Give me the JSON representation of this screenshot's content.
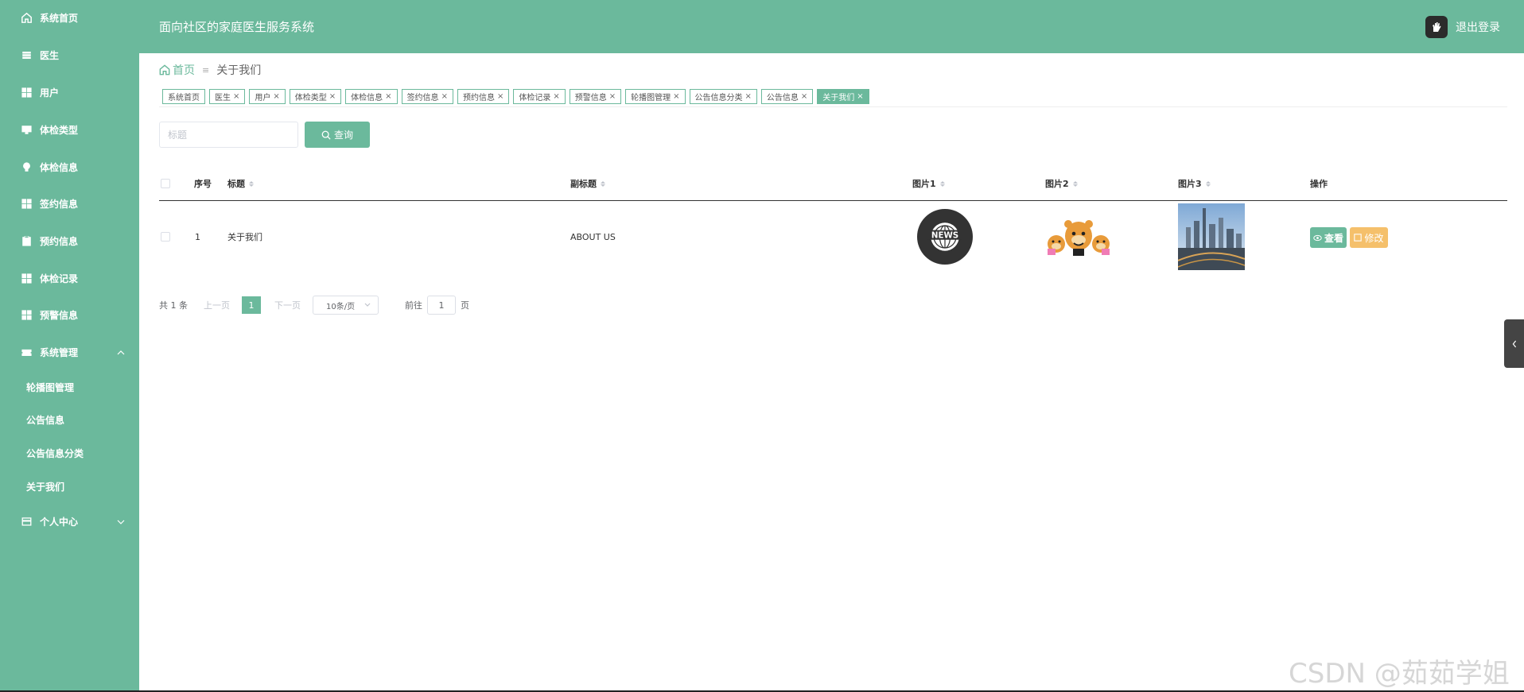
{
  "app_title": "面向社区的家庭医生服务系统",
  "logout_label": "退出登录",
  "sidebar": {
    "items": [
      {
        "label": "系统首页",
        "icon": "home-icon"
      },
      {
        "label": "医生",
        "icon": "menu-icon"
      },
      {
        "label": "用户",
        "icon": "grid-icon"
      },
      {
        "label": "体检类型",
        "icon": "monitor-icon"
      },
      {
        "label": "体检信息",
        "icon": "bulb-icon"
      },
      {
        "label": "签约信息",
        "icon": "grid-icon"
      },
      {
        "label": "预约信息",
        "icon": "clipboard-icon"
      },
      {
        "label": "体检记录",
        "icon": "grid-icon"
      },
      {
        "label": "预警信息",
        "icon": "grid-icon"
      },
      {
        "label": "系统管理",
        "icon": "ticket-icon"
      },
      {
        "label": "个人中心",
        "icon": "calendar-icon"
      }
    ],
    "sub_items": [
      "轮播图管理",
      "公告信息",
      "公告信息分类",
      "关于我们"
    ]
  },
  "breadcrumb": {
    "home": "首页",
    "current": "关于我们"
  },
  "tags": [
    {
      "label": "系统首页",
      "closable": false
    },
    {
      "label": "医生",
      "closable": true
    },
    {
      "label": "用户",
      "closable": true
    },
    {
      "label": "体检类型",
      "closable": true
    },
    {
      "label": "体检信息",
      "closable": true
    },
    {
      "label": "签约信息",
      "closable": true
    },
    {
      "label": "预约信息",
      "closable": true
    },
    {
      "label": "体检记录",
      "closable": true
    },
    {
      "label": "预警信息",
      "closable": true
    },
    {
      "label": "轮播图管理",
      "closable": true
    },
    {
      "label": "公告信息分类",
      "closable": true
    },
    {
      "label": "公告信息",
      "closable": true
    },
    {
      "label": "关于我们",
      "closable": true,
      "active": true
    }
  ],
  "search": {
    "placeholder": "标题",
    "button_label": "查询"
  },
  "table": {
    "columns": [
      "序号",
      "标题",
      "副标题",
      "图片1",
      "图片2",
      "图片3",
      "操作"
    ],
    "rows": [
      {
        "index": "1",
        "title": "关于我们",
        "subtitle": "ABOUT US",
        "image1_text": "NEWS"
      }
    ],
    "view_label": "查看",
    "edit_label": "修改"
  },
  "pager": {
    "total": "共 1 条",
    "prev": "上一页",
    "page": "1",
    "next": "下一页",
    "size": "10条/页",
    "goto": "前往",
    "goto_value": "1",
    "page_unit": "页"
  },
  "watermark": "CSDN @茹茹学姐",
  "colors": {
    "primary": "#6bb99c",
    "warning": "#f5c06b"
  }
}
